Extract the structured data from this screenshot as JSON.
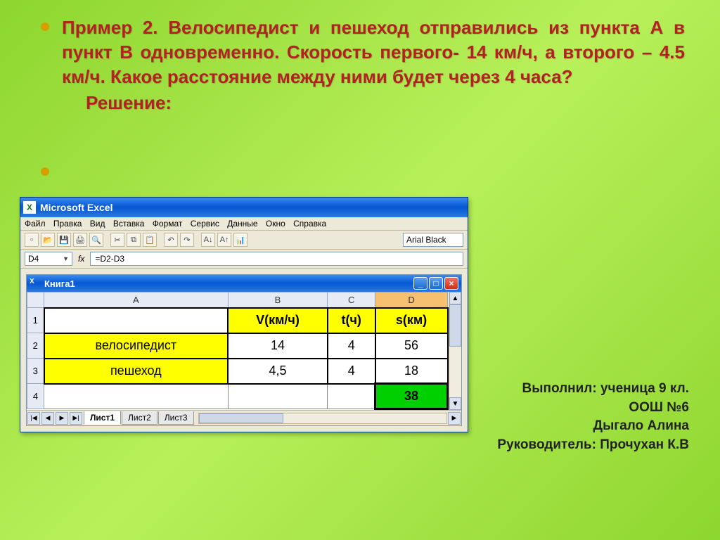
{
  "bullet1_text": "Пример 2. Велосипедист и пешеход отправились из пункта А в пункт В одновременно. Скорость первого- 14 км/ч, а второго – 4.5 км/ч. Какое расстояние между ними будет через 4 часа?",
  "bullet2_text": "Решение:",
  "credits": {
    "l1": "Выполнил: ученица 9 кл.",
    "l2": "ООШ №6",
    "l3": "Дыгало Алина",
    "l4": "Руководитель: Прочухан К.В"
  },
  "excel": {
    "app_title": "Microsoft Excel",
    "menu": [
      "Файл",
      "Правка",
      "Вид",
      "Вставка",
      "Формат",
      "Сервис",
      "Данные",
      "Окно",
      "Справка"
    ],
    "font_name": "Arial Black",
    "name_box": "D4",
    "fx_label": "fx",
    "formula": "=D2-D3",
    "workbook_title": "Книга1",
    "columns": [
      "A",
      "B",
      "C",
      "D"
    ],
    "rows": [
      {
        "n": "1",
        "A": "",
        "B": "V(км/ч)",
        "C": "t(ч)",
        "D": "s(км)",
        "header": true
      },
      {
        "n": "2",
        "A": "велосипедист",
        "B": "14",
        "C": "4",
        "D": "56"
      },
      {
        "n": "3",
        "A": "пешеход",
        "B": "4,5",
        "C": "4",
        "D": "18"
      },
      {
        "n": "4",
        "A": "",
        "B": "",
        "C": "",
        "D": "38",
        "result": true
      }
    ],
    "tabs": [
      "Лист1",
      "Лист2",
      "Лист3"
    ],
    "active_tab": 0
  },
  "icons": {
    "excel": "X",
    "min": "_",
    "max": "□",
    "close": "×",
    "up": "▲",
    "down": "▼",
    "left": "◀",
    "right": "▶",
    "first": "|◀",
    "last": "▶|"
  },
  "colors": {
    "accent_blue": "#0a5ad4",
    "yellow": "#ffff00",
    "green": "#00d000",
    "red_text": "#b22222"
  }
}
